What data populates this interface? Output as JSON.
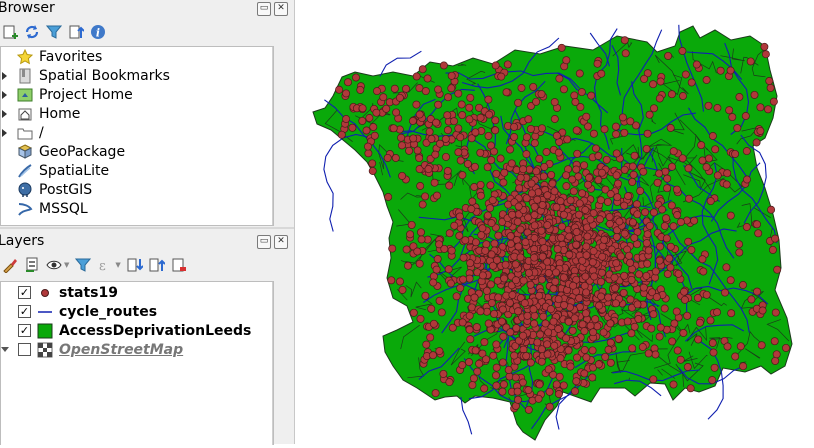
{
  "browser": {
    "title": "Browser",
    "items": [
      {
        "label": "Favorites",
        "icon": "star-icon"
      },
      {
        "label": "Spatial Bookmarks",
        "icon": "bookmark-icon"
      },
      {
        "label": "Project Home",
        "icon": "project-home-icon"
      },
      {
        "label": "Home",
        "icon": "home-icon"
      },
      {
        "label": "/",
        "icon": "folder-icon"
      },
      {
        "label": "GeoPackage",
        "icon": "geopackage-icon"
      },
      {
        "label": "SpatiaLite",
        "icon": "spatialite-icon"
      },
      {
        "label": "PostGIS",
        "icon": "postgis-icon"
      },
      {
        "label": "MSSQL",
        "icon": "mssql-icon"
      }
    ]
  },
  "layers": {
    "title": "Layers",
    "items": [
      {
        "label": "stats19",
        "checked": true,
        "icon": "point-symbol-icon"
      },
      {
        "label": "cycle_routes",
        "checked": true,
        "icon": "line-symbol-icon"
      },
      {
        "label": "AccessDeprivationLeeds",
        "checked": true,
        "icon": "polygon-symbol-icon"
      },
      {
        "label": "OpenStreetMap",
        "checked": false,
        "icon": "raster-tile-icon"
      }
    ]
  },
  "colors": {
    "map_fill": "#0aa90a",
    "boundary": "#1b3a1b",
    "route": "#1020b0",
    "point_fill": "#b0393b",
    "point_stroke": "#4a1a1a"
  }
}
